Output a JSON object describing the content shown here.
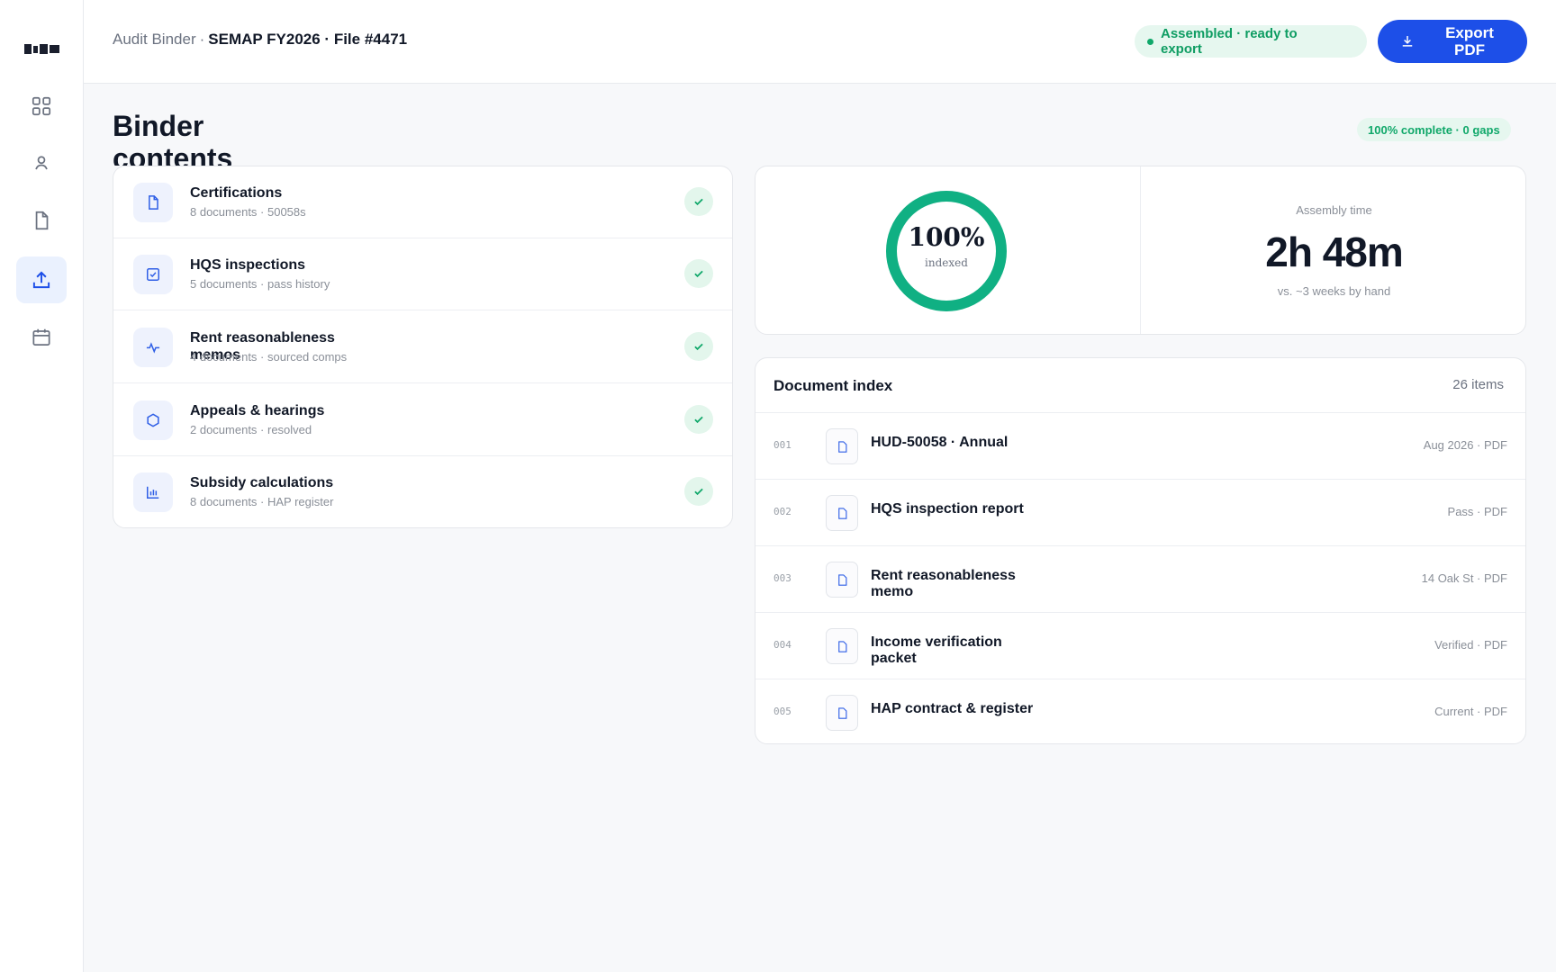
{
  "header": {
    "crumb_section": "Audit Binder",
    "crumb_separator": "·",
    "crumb_file": "SEMAP FY2026 · File #4471",
    "status_text": "Assembled · ready to export",
    "export_label": "Export PDF"
  },
  "sidebar": {
    "items": [
      {
        "icon": "grid-icon"
      },
      {
        "icon": "user-icon"
      },
      {
        "icon": "document-icon"
      },
      {
        "icon": "upload-icon",
        "active": true
      },
      {
        "icon": "calendar-icon"
      }
    ]
  },
  "binder": {
    "title": "Binder contents",
    "complete_badge": "100% complete · 0 gaps",
    "categories": [
      {
        "title": "Certifications",
        "subtitle": "8 documents · 50058s",
        "icon": "document-icon"
      },
      {
        "title": "HQS inspections",
        "subtitle": "5 documents · pass history",
        "icon": "checkbox-icon"
      },
      {
        "title": "Rent reasonableness memos",
        "subtitle": "4 documents · sourced comps",
        "icon": "activity-icon"
      },
      {
        "title": "Appeals & hearings",
        "subtitle": "2 documents · resolved",
        "icon": "hexagon-icon"
      },
      {
        "title": "Subsidy calculations",
        "subtitle": "8 documents · HAP register",
        "icon": "bar-chart-icon"
      }
    ]
  },
  "stats": {
    "percent": "100%",
    "percent_value": 1.0,
    "percent_label": "indexed",
    "assembly_label": "Assembly time",
    "assembly_value": "2h 48m",
    "assembly_sub": "vs. ~3 weeks by hand",
    "ring_color": "#10b083"
  },
  "doc_index": {
    "title": "Document index",
    "count": "26 items",
    "rows": [
      {
        "num": "001",
        "title": "HUD-50058 · Annual",
        "meta": "Aug 2026 · PDF"
      },
      {
        "num": "002",
        "title": "HQS inspection report",
        "meta": "Pass · PDF"
      },
      {
        "num": "003",
        "title": "Rent reasonableness memo",
        "meta": "14 Oak St · PDF"
      },
      {
        "num": "004",
        "title": "Income verification packet",
        "meta": "Verified · PDF"
      },
      {
        "num": "005",
        "title": "HAP contract & register",
        "meta": "Current · PDF"
      }
    ]
  },
  "colors": {
    "accent": "#1d4fe8",
    "success": "#10a86a"
  }
}
